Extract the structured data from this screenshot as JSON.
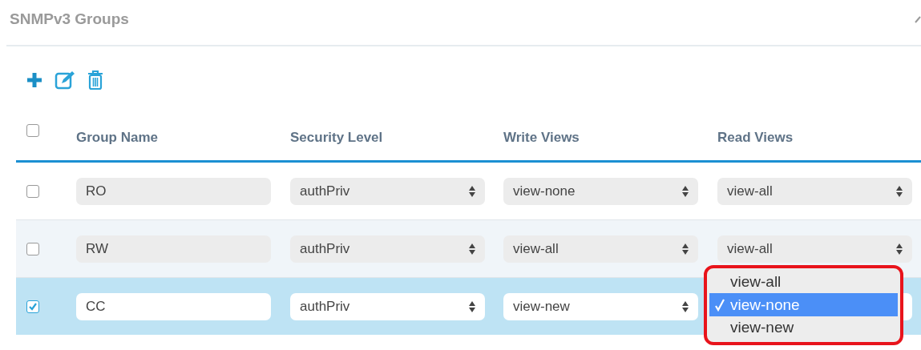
{
  "panel": {
    "title": "SNMPv3 Groups"
  },
  "table": {
    "columns": [
      "Group Name",
      "Security Level",
      "Write Views",
      "Read Views"
    ],
    "header_checked": false,
    "rows": [
      {
        "checked": false,
        "group_name": "RO",
        "security_level": "authPriv",
        "write_views": "view-none",
        "read_views": "view-all"
      },
      {
        "checked": false,
        "group_name": "RW",
        "security_level": "authPriv",
        "write_views": "view-all",
        "read_views": "view-all"
      },
      {
        "checked": true,
        "group_name": "CC",
        "security_level": "authPriv",
        "write_views": "view-new",
        "read_dropdown": {
          "highlighted": true,
          "options": [
            {
              "label": "view-all",
              "selected": false
            },
            {
              "label": "view-none",
              "selected": true
            },
            {
              "label": "view-new",
              "selected": false
            }
          ]
        }
      }
    ]
  }
}
